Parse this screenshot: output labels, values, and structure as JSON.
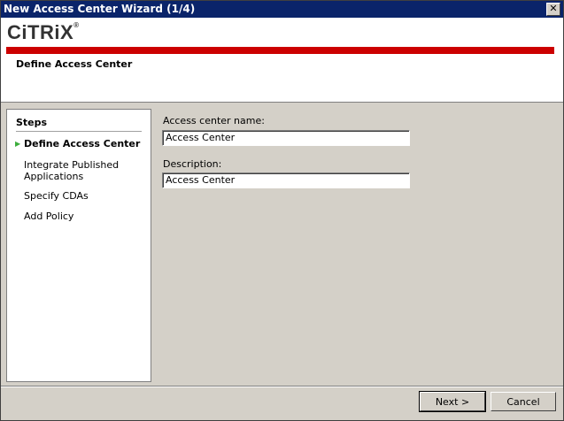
{
  "window": {
    "title": "New Access Center Wizard (1/4)",
    "close_glyph": "✕"
  },
  "header": {
    "logo_text": "CiTRiX",
    "logo_mark": "®",
    "page_title": "Define Access Center"
  },
  "steps": {
    "heading": "Steps",
    "items": [
      {
        "label": "Define Access Center",
        "active": true
      },
      {
        "label": "Integrate Published Applications",
        "active": false
      },
      {
        "label": "Specify CDAs",
        "active": false
      },
      {
        "label": "Add Policy",
        "active": false
      }
    ]
  },
  "form": {
    "name_label": "Access center name:",
    "name_value": "Access Center",
    "description_label": "Description:",
    "description_value": "Access Center"
  },
  "buttons": {
    "next": "Next >",
    "cancel": "Cancel"
  },
  "icons": {
    "active_step": "green-arrow-icon"
  },
  "colors": {
    "title_bar": "#0a246a",
    "brand_red": "#cc0000",
    "active_arrow": "#3cad3c"
  }
}
